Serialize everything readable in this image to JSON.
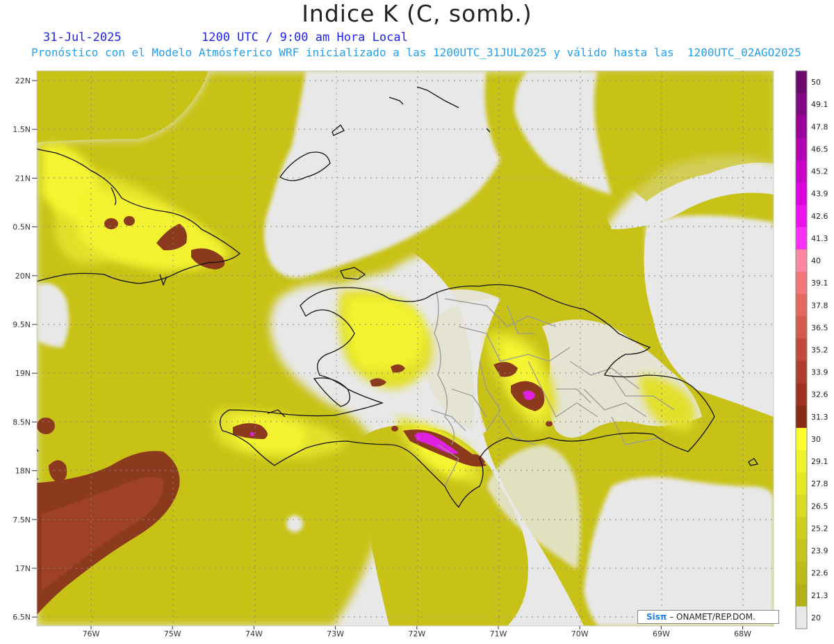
{
  "header": {
    "title": "Indice K (C, somb.)",
    "date": "31-Jul-2025",
    "time": "1200 UTC / 9:00 am Hora Local",
    "subtitle": "Pronóstico con el Modelo Atmósferico WRF inicializado a las 1200UTC_31JUL2025 y válido hasta las  1200UTC_02AGO2025"
  },
  "map": {
    "lat_labels": [
      "22N",
      "1.5N",
      "21N",
      "0.5N",
      "20N",
      "9.5N",
      "19N",
      "8.5N",
      "18N",
      "7.5N",
      "17N",
      "6.5N"
    ],
    "lon_labels": [
      "76W",
      "75W",
      "74W",
      "73W",
      "72W",
      "71W",
      "70W",
      "69W",
      "68W"
    ],
    "colors": {
      "background": "#e8e8e8",
      "low_yellow": "#c8c218",
      "mid_yellow": "#dedc24",
      "high_yellow": "#f4f430",
      "brown": "#8b3a1e",
      "magenta": "#e020e0",
      "coastline": "#111111",
      "borders": "#999999"
    }
  },
  "colorbar": {
    "labels": [
      "50",
      "49.1",
      "47.8",
      "46.5",
      "45.2",
      "43.9",
      "42.6",
      "41.3",
      "40",
      "39.1",
      "37.8",
      "36.5",
      "35.2",
      "33.9",
      "32.6",
      "31.3",
      "30",
      "29.1",
      "27.8",
      "26.5",
      "25.2",
      "23.9",
      "22.6",
      "21.3",
      "20"
    ],
    "colors": [
      "#6a0a6a",
      "#800880",
      "#990099",
      "#b000b0",
      "#c800c8",
      "#dc00dc",
      "#ec10ec",
      "#f830f8",
      "#ff88a0",
      "#f07878",
      "#e06a60",
      "#d05c4c",
      "#c04c3a",
      "#b03e2c",
      "#9c3420",
      "#8a2c14",
      "#ffff30",
      "#f2f22a",
      "#e6e626",
      "#dada22",
      "#cece1e",
      "#c4c41c",
      "#bcbc18",
      "#b2b216",
      "#e8e8e8"
    ]
  },
  "credit": {
    "brand": "Sisπ",
    "org": " – ONAMET/REP.DOM."
  }
}
